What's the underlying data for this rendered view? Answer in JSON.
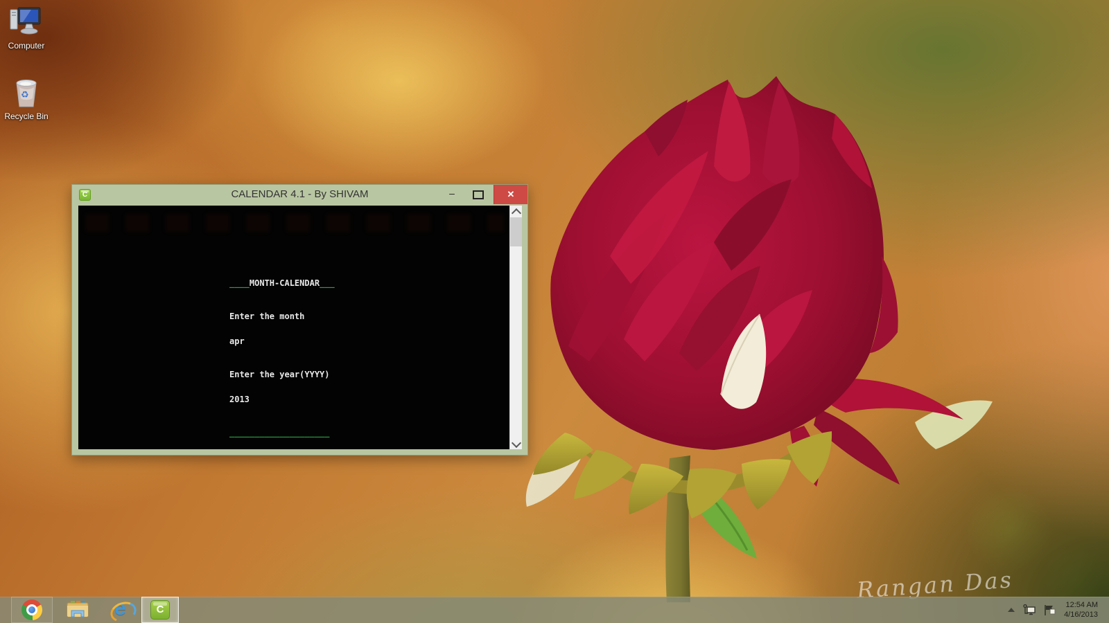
{
  "desktop": {
    "icons": [
      {
        "label": "Computer"
      },
      {
        "label": "Recycle Bin",
        "symbol": "♻"
      }
    ],
    "watermark": "Rangan Das"
  },
  "window": {
    "title": "CALENDAR 4.1 - By SHIVAM",
    "icon_glyph": "C",
    "controls": {
      "minimize_glyph": "–",
      "close_glyph": "✕"
    },
    "console": {
      "heading_rule_left": "____",
      "heading": "MONTH-CALENDAR",
      "heading_rule_right": "___",
      "prompt_month": "Enter the month",
      "input_month": "apr",
      "prompt_year": "Enter the year(YYYY)",
      "input_year": "2013",
      "bottom_rule": "____________________"
    }
  },
  "taskbar": {
    "buttons": [
      {
        "icon": "chrome-icon"
      },
      {
        "icon": "file-explorer-icon"
      },
      {
        "icon": "internet-explorer-icon",
        "glyph": "e"
      },
      {
        "icon": "calendar-app-icon",
        "glyph": "C",
        "active": true
      }
    ],
    "tray": {
      "time": "12:54 AM",
      "date": "4/16/2013"
    }
  },
  "colors": {
    "titlebar_green": "#b9c6a2",
    "close_red": "#ce4a44",
    "console_green": "#2f9e41",
    "console_bg": "#030303",
    "taskbar_olive": "#868a75",
    "petal_red": "#a81236",
    "sepal_yellow": "#bfae38"
  }
}
